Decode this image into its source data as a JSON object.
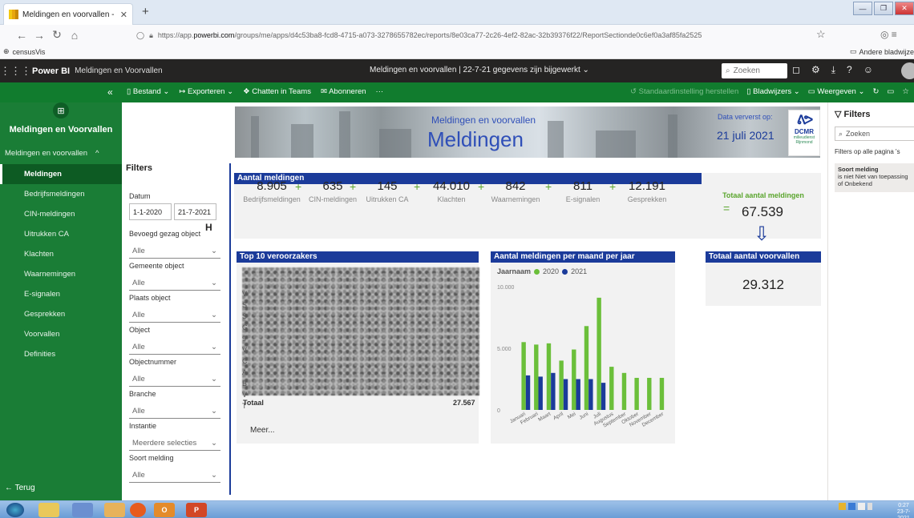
{
  "browser": {
    "tab_title": "Meldingen en voorvallen - Pow",
    "new_tab": "+",
    "url_prefix": "https://app.",
    "url_domain": "powerbi.com",
    "url_rest": "/groups/me/apps/d4c53ba8-fcd8-4715-a073-3278655782ec/reports/8e03ca77-2c26-4ef2-82ac-32b39376f22/ReportSectionde0c6ef0a3af85fa2525",
    "bookmark": "censusVis",
    "other_bookmarks": "Andere bladwijze"
  },
  "pbi": {
    "brand": "Power BI",
    "workspace": "Meldingen en Voorvallen",
    "report_status": "Meldingen en voorvallen  |  22-7-21 gegevens zijn bijgewerkt",
    "search_placeholder": "Zoeken"
  },
  "toolbar": {
    "file": "Bestand",
    "export": "Exporteren",
    "teams": "Chatten in Teams",
    "subscribe": "Abonneren",
    "more": "···",
    "reset": "Standaardinstelling herstellen",
    "bookmarks": "Bladwijzers",
    "view": "Weergeven"
  },
  "leftnav": {
    "app_name": "Meldingen en Voorvallen",
    "section": "Meldingen en voorvallen",
    "items": [
      {
        "label": "Meldingen"
      },
      {
        "label": "Bedrijfsmeldingen"
      },
      {
        "label": "CIN-meldingen"
      },
      {
        "label": "Uitrukken CA"
      },
      {
        "label": "Klachten"
      },
      {
        "label": "Waarnemingen"
      },
      {
        "label": "E-signalen"
      },
      {
        "label": "Gesprekken"
      },
      {
        "label": "Voorvallen"
      },
      {
        "label": "Definities"
      }
    ],
    "back": "Terug"
  },
  "banner": {
    "subtitle": "Meldingen en voorvallen",
    "title": "Meldingen",
    "data_refreshed_label": "Data ververst op:",
    "data_refreshed_date": "21 juli 2021",
    "logo_text": "DCMR",
    "logo_sub": "milieudienst Rijnmond"
  },
  "filters": {
    "title": "Filters",
    "date_label": "Datum",
    "date_from": "1-1-2020",
    "date_to": "21-7-2021",
    "slicers": [
      {
        "label": "Bevoegd gezag object",
        "value": "Alle"
      },
      {
        "label": "Gemeente object",
        "value": "Alle"
      },
      {
        "label": "Plaats object",
        "value": "Alle"
      },
      {
        "label": "Object",
        "value": "Alle"
      },
      {
        "label": "Objectnummer",
        "value": "Alle"
      },
      {
        "label": "Branche",
        "value": "Alle"
      },
      {
        "label": "Instantie",
        "value": "Meerdere selecties"
      },
      {
        "label": "Soort melding",
        "value": "Alle"
      }
    ]
  },
  "aantal": {
    "header": "Aantal meldingen",
    "kpis": [
      {
        "value": "8.905",
        "label": "Bedrijfsmeldingen"
      },
      {
        "value": "635",
        "label": "CIN-meldingen"
      },
      {
        "value": "145",
        "label": "Uitrukken CA"
      },
      {
        "value": "44.010",
        "label": "Klachten"
      },
      {
        "value": "842",
        "label": "Waarnemingen"
      },
      {
        "value": "811",
        "label": "E-signalen"
      },
      {
        "value": "12.191",
        "label": "Gesprekken"
      }
    ],
    "plus": "+",
    "total_label": "Totaal aantal meldingen",
    "equals": "=",
    "total_value": "67.539"
  },
  "top10": {
    "header": "Top 10 veroorzakers",
    "total_label": "Totaal",
    "total_value": "27.567",
    "more": "Meer..."
  },
  "voorvallen": {
    "header": "Totaal aantal voorvallen",
    "value": "29.312"
  },
  "filterpane": {
    "title": "Filters",
    "search": "Zoeken",
    "section": "Filters op alle pagina 's",
    "card_title": "Soort melding",
    "card_text": "is niet Niet van toepassing of Onbekend"
  },
  "taskbar": {
    "time": "0:27",
    "date": "23-7-2021"
  },
  "chart_data": {
    "type": "bar",
    "title": "Aantal meldingen per maand per jaar",
    "legend_title": "Jaarnaam",
    "categories": [
      "Januari",
      "Februari",
      "Maart",
      "April",
      "Mei",
      "Juni",
      "Juli",
      "Augustus",
      "September",
      "Oktober",
      "November",
      "December"
    ],
    "series": [
      {
        "name": "2020",
        "color": "#6bbf3a",
        "values": [
          5500,
          5300,
          5400,
          4000,
          4900,
          6800,
          9100,
          3500,
          3000,
          2600,
          2600,
          2600
        ]
      },
      {
        "name": "2021",
        "color": "#1b3b9a",
        "values": [
          2800,
          2700,
          3000,
          2500,
          2500,
          2500,
          2200,
          0,
          0,
          0,
          0,
          0
        ]
      }
    ],
    "ylim": [
      0,
      10000
    ],
    "yticks": [
      "0",
      "5.000",
      "10.000"
    ],
    "legend": "top-left"
  }
}
